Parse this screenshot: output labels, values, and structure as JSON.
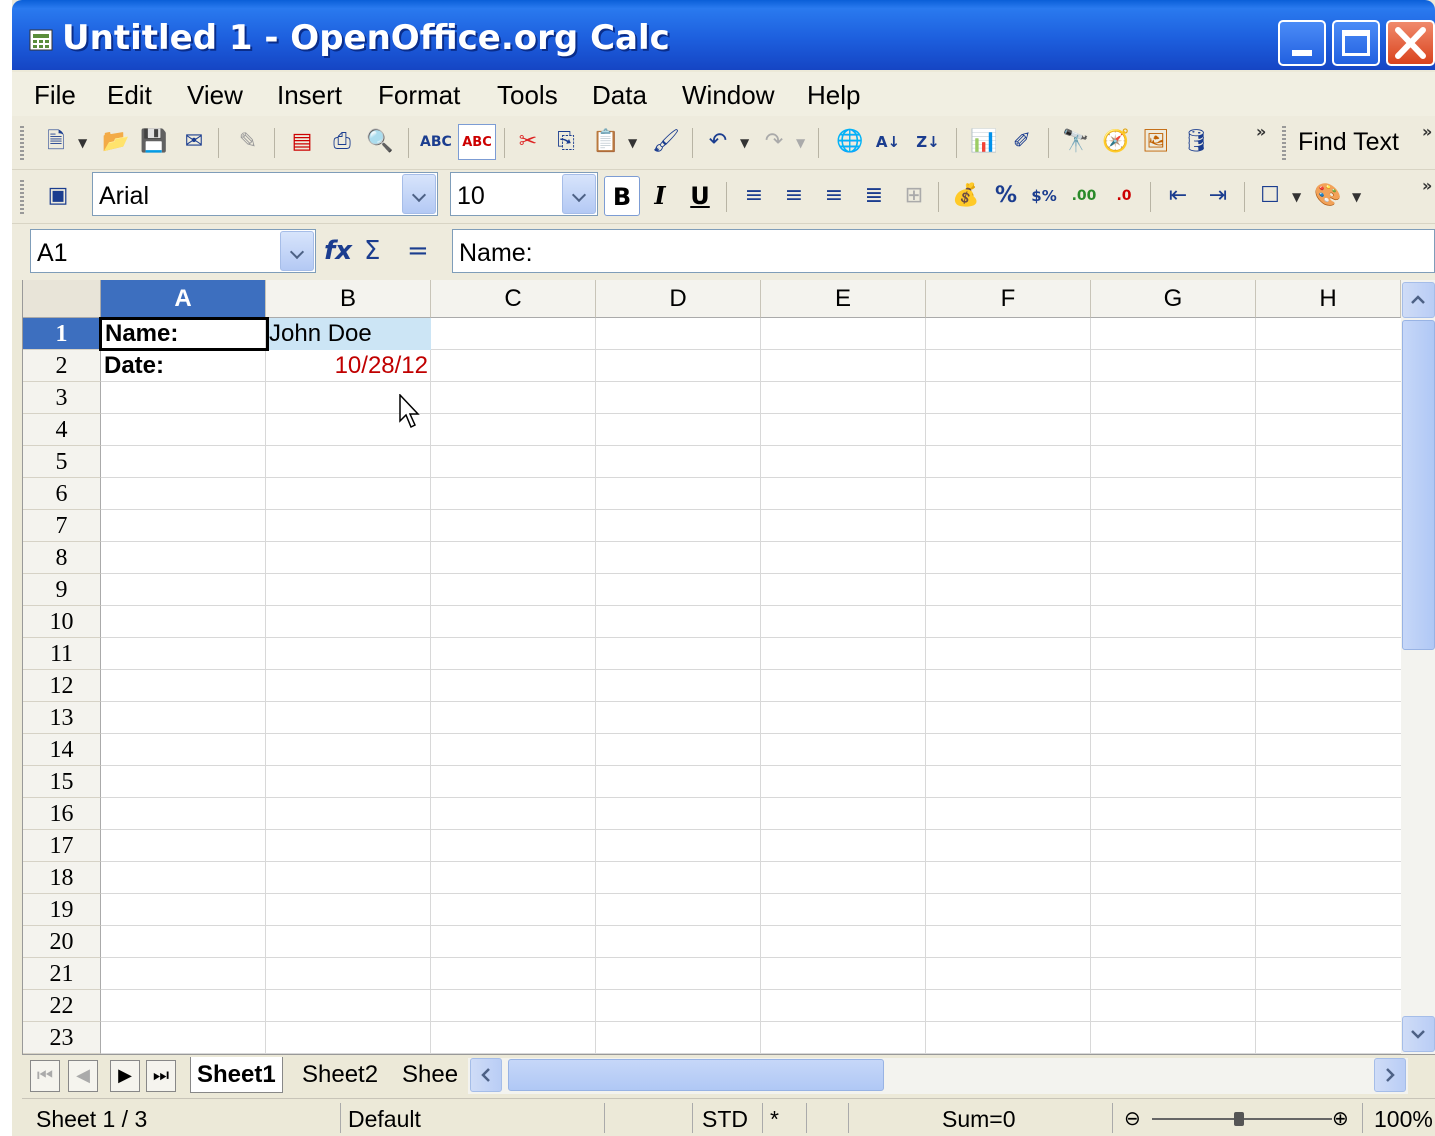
{
  "window": {
    "title": "Untitled 1 - OpenOffice.org Calc"
  },
  "menu": [
    "File",
    "Edit",
    "View",
    "Insert",
    "Format",
    "Tools",
    "Data",
    "Window",
    "Help"
  ],
  "toolbar": {
    "find_text": "Find Text"
  },
  "format_toolbar": {
    "font_name": "Arial",
    "font_size": "10",
    "bold": "B",
    "italic": "I",
    "underline": "U"
  },
  "formula_bar": {
    "cell_ref": "A1",
    "content": "Name:",
    "fx_icon": "function-wizard-icon",
    "sum_icon": "sum-icon",
    "equals": "="
  },
  "columns": [
    "A",
    "B",
    "C",
    "D",
    "E",
    "F",
    "G",
    "H"
  ],
  "rows": [
    "1",
    "2",
    "3",
    "4",
    "5",
    "6",
    "7",
    "8",
    "9",
    "10",
    "11",
    "12",
    "13",
    "14",
    "15",
    "16",
    "17",
    "18",
    "19",
    "20",
    "21",
    "22",
    "23"
  ],
  "cells": {
    "A1": "Name:",
    "B1": "John Doe",
    "A2": "Date:",
    "B2": "10/28/12"
  },
  "sheets": [
    "Sheet1",
    "Sheet2",
    "Shee"
  ],
  "status": {
    "sheet_pos": "Sheet 1 / 3",
    "page_style": "Default",
    "mode": "STD",
    "modified": "*",
    "sum": "Sum=0",
    "zoom": "100%"
  },
  "colors": {
    "title_bar": "#1d5fde",
    "selected_header": "#3d6fbf",
    "date_text": "#c00000",
    "highlight": "#cce5f5"
  }
}
